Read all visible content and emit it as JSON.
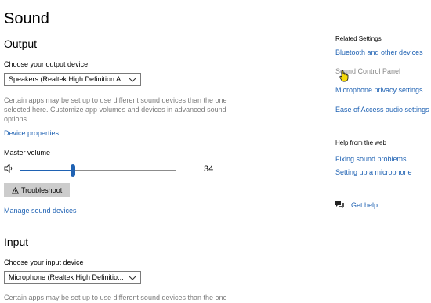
{
  "title": "Sound",
  "output": {
    "heading": "Output",
    "device_label": "Choose your output device",
    "device_value": "Speakers (Realtek High Definition A...",
    "description": "Certain apps may be set up to use different sound devices than the one selected here. Customize app volumes and devices in advanced sound options.",
    "device_properties": "Device properties",
    "master_volume_label": "Master volume",
    "volume": 34,
    "troubleshoot": "Troubleshoot",
    "manage_devices": "Manage sound devices"
  },
  "input": {
    "heading": "Input",
    "device_label": "Choose your input device",
    "device_value": "Microphone (Realtek High Definitio...",
    "description": "Certain apps may be set up to use different sound devices than the one"
  },
  "related": {
    "heading": "Related Settings",
    "links": [
      "Bluetooth and other devices",
      "Sound Control Panel",
      "Microphone privacy settings",
      "Ease of Access audio settings"
    ]
  },
  "help": {
    "heading": "Help from the web",
    "links": [
      "Fixing sound problems",
      "Setting up a microphone"
    ],
    "get_help": "Get help"
  },
  "colors": {
    "accent": "#1f62b3",
    "button": "#cccccc",
    "track": "#8c8c8c",
    "cursor": "#f5d90a"
  },
  "icons": [
    "speaker-icon",
    "warning-icon",
    "chevron-down-icon",
    "chat-help-icon",
    "hand-cursor-icon"
  ]
}
